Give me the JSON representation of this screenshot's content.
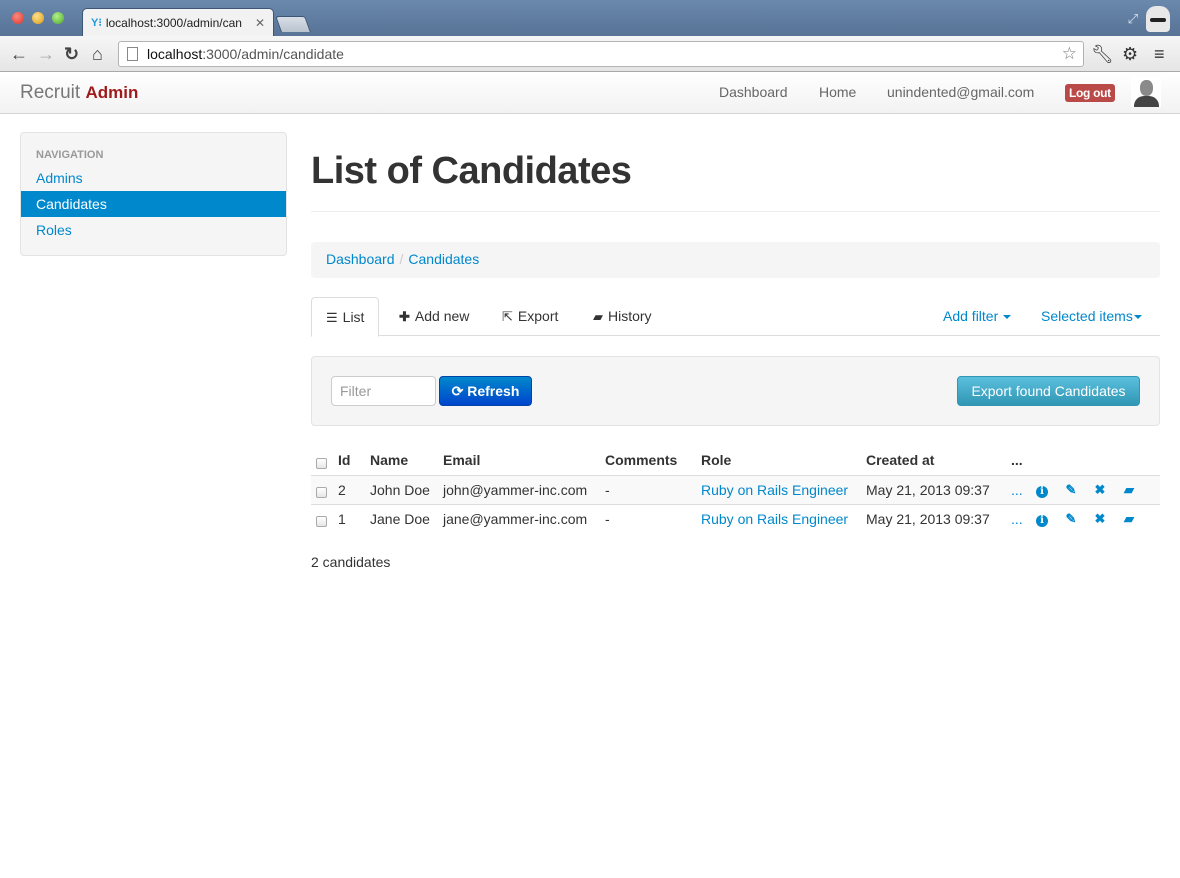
{
  "browser": {
    "tab_title": "localhost:3000/admin/can",
    "tab_favicon": "Y⁝",
    "url_host": "localhost",
    "url_path": ":3000/admin/candidate",
    "icons": [
      "back-icon",
      "forward-icon",
      "reload-icon",
      "home-icon",
      "bookmark-star-icon",
      "wrench-icon",
      "gear-icon",
      "menu-icon",
      "fullscreen-icon",
      "incognito-icon"
    ]
  },
  "app": {
    "brand": "Recruit",
    "brand_sub": "Admin",
    "topnav": {
      "dashboard": "Dashboard",
      "home": "Home",
      "user_email": "unindented@gmail.com",
      "logout": "Log out"
    }
  },
  "sidebar": {
    "header": "Navigation",
    "items": [
      {
        "label": "Admins",
        "active": false
      },
      {
        "label": "Candidates",
        "active": true
      },
      {
        "label": "Roles",
        "active": false
      }
    ]
  },
  "main": {
    "title": "List of Candidates",
    "breadcrumb": [
      "Dashboard",
      "Candidates"
    ],
    "breadcrumb_sep": "/",
    "tabs": [
      {
        "label": "List",
        "icon": "list-icon",
        "active": true
      },
      {
        "label": "Add new",
        "icon": "plus-icon",
        "active": false
      },
      {
        "label": "Export",
        "icon": "share-icon",
        "active": false
      },
      {
        "label": "History",
        "icon": "book-icon",
        "active": false
      }
    ],
    "dropdowns": {
      "add_filter": "Add filter",
      "selected_items": "Selected items"
    },
    "filter": {
      "placeholder": "Filter",
      "value": "",
      "refresh": "Refresh",
      "export": "Export found Candidates"
    },
    "table": {
      "columns": [
        "Id",
        "Name",
        "Email",
        "Comments",
        "Role",
        "Created at",
        "..."
      ],
      "rows": [
        {
          "id": "2",
          "name": "John Doe",
          "email": "john@yammer-inc.com",
          "comments": "-",
          "role": "Ruby on Rails Engineer",
          "created_at": "May 21, 2013 09:37",
          "more": "..."
        },
        {
          "id": "1",
          "name": "Jane Doe",
          "email": "jane@yammer-inc.com",
          "comments": "-",
          "role": "Ruby on Rails Engineer",
          "created_at": "May 21, 2013 09:37",
          "more": "..."
        }
      ],
      "row_actions": [
        "info-icon",
        "edit-pencil-icon",
        "delete-icon",
        "history-book-icon"
      ]
    },
    "count": "2 candidates"
  },
  "colors": {
    "link": "#0088cc",
    "brand_accent": "#9e1b1b",
    "logout_bg": "#b94a48",
    "primary_btn": "#0055cc",
    "info_btn": "#2f96b4"
  }
}
